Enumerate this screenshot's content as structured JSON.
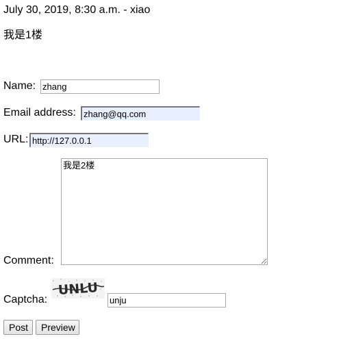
{
  "comment": {
    "meta": "July 30, 2019, 8:30 a.m. - xiao",
    "body": "我是1楼"
  },
  "form": {
    "name": {
      "label": "Name:",
      "value": "zhang"
    },
    "email": {
      "label": "Email address:",
      "value": "zhang@qq.com"
    },
    "url": {
      "label": "URL:",
      "value": "http://127.0.0.1"
    },
    "comment": {
      "label": "Comment:",
      "value": "我是2楼"
    },
    "captcha": {
      "label": "Captcha:",
      "value": "unju",
      "image_text": "UNLU"
    },
    "buttons": {
      "post": "Post",
      "preview": "Preview"
    }
  }
}
